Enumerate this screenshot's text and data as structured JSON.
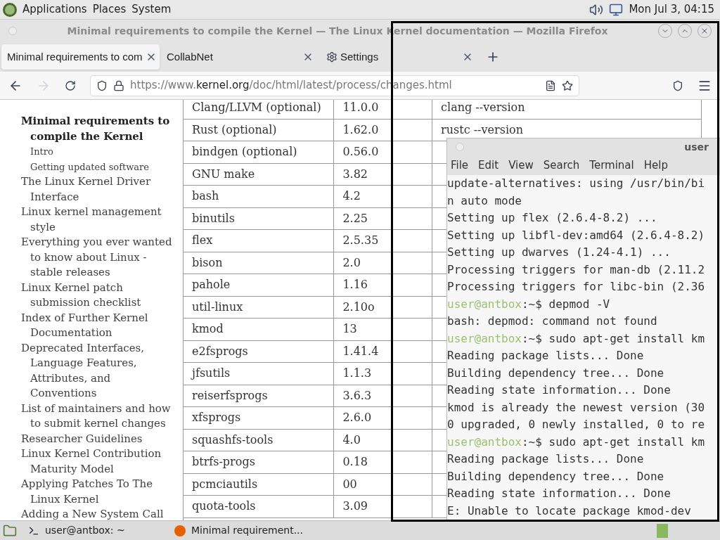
{
  "top_panel": {
    "menus": [
      "Applications",
      "Places",
      "System"
    ],
    "clock": "Mon Jul 3, 04:15"
  },
  "browser": {
    "title": "Minimal requirements to compile the Kernel — The Linux Kernel documentation — Mozilla Firefox",
    "tabs": [
      {
        "label": "Minimal requirements to com",
        "selected": true,
        "kind": "page"
      },
      {
        "label": "CollabNet",
        "selected": false,
        "kind": "page"
      },
      {
        "label": "Settings",
        "selected": false,
        "kind": "settings"
      }
    ],
    "nav": {
      "forward_disabled": true
    },
    "url": {
      "scheme": "https://www.",
      "domain": "kernel.org",
      "path": "/doc/html/latest/process/changes.html"
    },
    "sidebar": [
      {
        "text": "Minimal requirements to compile the Kernel",
        "current": true,
        "children": [
          {
            "text": "Intro"
          },
          {
            "text": "Getting updated software"
          }
        ]
      },
      {
        "text": "The Linux Kernel Driver Interface",
        "current": false
      },
      {
        "text": "Linux kernel management style",
        "current": false
      },
      {
        "text": "Everything you ever wanted to know about Linux -stable releases",
        "current": false
      },
      {
        "text": "Linux Kernel patch submission checklist",
        "current": false
      },
      {
        "text": "Index of Further Kernel Documentation",
        "current": false
      },
      {
        "text": "Deprecated Interfaces, Language Features, Attributes, and Conventions",
        "current": false
      },
      {
        "text": "List of maintainers and how to submit kernel changes",
        "current": false
      },
      {
        "text": "Researcher Guidelines",
        "current": false
      },
      {
        "text": "Linux Kernel Contribution Maturity Model",
        "current": false
      },
      {
        "text": "Applying Patches To The Linux Kernel",
        "current": false
      },
      {
        "text": "Adding a New System Call",
        "current": false
      }
    ],
    "table": {
      "rows": [
        [
          "Clang/LLVM (optional)",
          "11.0.0",
          "clang --version"
        ],
        [
          "Rust (optional)",
          "1.62.0",
          "rustc --version"
        ],
        [
          "bindgen (optional)",
          "0.56.0"
        ],
        [
          "GNU make",
          "3.82"
        ],
        [
          "bash",
          "4.2"
        ],
        [
          "binutils",
          "2.25"
        ],
        [
          "flex",
          "2.5.35"
        ],
        [
          "bison",
          "2.0"
        ],
        [
          "pahole",
          "1.16"
        ],
        [
          "util-linux",
          "2.10o"
        ],
        [
          "kmod",
          "13"
        ],
        [
          "e2fsprogs",
          "1.41.4"
        ],
        [
          "jfsutils",
          "1.1.3"
        ],
        [
          "reiserfsprogs",
          "3.6.3"
        ],
        [
          "xfsprogs",
          "2.6.0"
        ],
        [
          "squashfs-tools",
          "4.0"
        ],
        [
          "btrfs-progs",
          "0.18"
        ],
        [
          "pcmciautils",
          "00"
        ],
        [
          "quota-tools",
          "3.09"
        ]
      ]
    }
  },
  "terminal": {
    "title": "user",
    "menus": [
      "File",
      "Edit",
      "View",
      "Search",
      "Terminal",
      "Help"
    ],
    "lines": [
      {
        "kind": "output",
        "text": "update-alternatives: using /usr/bin/bi"
      },
      {
        "kind": "output",
        "text": "n auto mode"
      },
      {
        "kind": "output",
        "text": "Setting up flex (2.6.4-8.2) ..."
      },
      {
        "kind": "output",
        "text": "Setting up libfl-dev:amd64 (2.6.4-8.2)"
      },
      {
        "kind": "output",
        "text": "Setting up dwarves (1.24-4.1) ..."
      },
      {
        "kind": "output",
        "text": "Processing triggers for man-db (2.11.2"
      },
      {
        "kind": "output",
        "text": "Processing triggers for libc-bin (2.36"
      },
      {
        "kind": "prompt",
        "host": "user@antbox",
        "text": ":~$ depmod -V"
      },
      {
        "kind": "output",
        "text": "bash: depmod: command not found"
      },
      {
        "kind": "prompt",
        "host": "user@antbox",
        "text": ":~$ sudo apt-get install km"
      },
      {
        "kind": "output",
        "text": "Reading package lists... Done"
      },
      {
        "kind": "output",
        "text": "Building dependency tree... Done"
      },
      {
        "kind": "output",
        "text": "Reading state information... Done"
      },
      {
        "kind": "output",
        "text": "kmod is already the newest version (30"
      },
      {
        "kind": "output",
        "text": "0 upgraded, 0 newly installed, 0 to re"
      },
      {
        "kind": "prompt",
        "host": "user@antbox",
        "text": ":~$ sudo apt-get install km"
      },
      {
        "kind": "output",
        "text": "Reading package lists... Done"
      },
      {
        "kind": "output",
        "text": "Building dependency tree... Done"
      },
      {
        "kind": "output",
        "text": "Reading state information... Done"
      },
      {
        "kind": "output",
        "text": "E: Unable to locate package kmod-dev"
      }
    ]
  },
  "taskbar": {
    "tasks": [
      {
        "label": "user@antbox: ~",
        "kind": "terminal"
      },
      {
        "label": "Minimal requirement...",
        "kind": "browser"
      }
    ]
  }
}
